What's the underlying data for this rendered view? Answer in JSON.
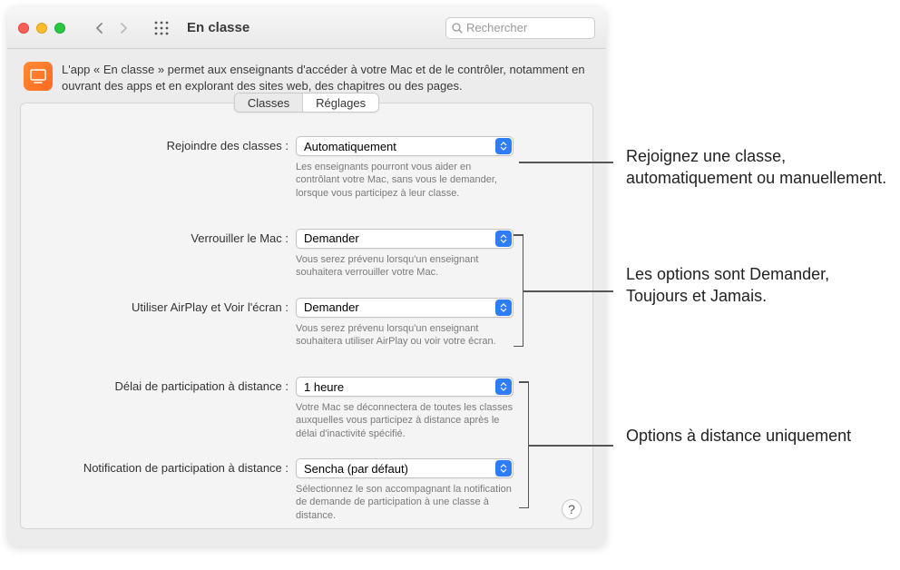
{
  "window": {
    "title": "En classe",
    "search_placeholder": "Rechercher"
  },
  "description": "L'app « En classe » permet aux enseignants d'accéder à votre Mac et de le contrôler, notamment en ouvrant des apps et en explorant des sites web, des chapitres ou des pages.",
  "tabs": {
    "classes": "Classes",
    "settings": "Réglages"
  },
  "settings": {
    "join": {
      "label": "Rejoindre des classes :",
      "value": "Automatiquement",
      "help": "Les enseignants pourront vous aider en contrôlant votre Mac, sans vous le demander, lorsque vous participez à leur classe."
    },
    "lock": {
      "label": "Verrouiller le Mac :",
      "value": "Demander",
      "help": "Vous serez prévenu lorsqu'un enseignant souhaitera verrouiller votre Mac."
    },
    "airplay": {
      "label": "Utiliser AirPlay et Voir l'écran :",
      "value": "Demander",
      "help": "Vous serez prévenu lorsqu'un enseignant souhaitera utiliser AirPlay ou voir votre écran."
    },
    "timeout": {
      "label": "Délai de participation à distance :",
      "value": "1 heure",
      "help": "Votre Mac se déconnectera de toutes les classes auxquelles vous participez à distance après le délai d'inactivité spécifié."
    },
    "notification": {
      "label": "Notification de participation à distance :",
      "value": "Sencha (par défaut)",
      "help": "Sélectionnez le son accompagnant la notification de demande de participation à une classe à distance."
    }
  },
  "help_button": "?",
  "callouts": {
    "c1": "Rejoignez une classe, automatiquement ou manuellement.",
    "c2": "Les options sont Demander, Toujours et Jamais.",
    "c3": "Options à distance uniquement"
  }
}
